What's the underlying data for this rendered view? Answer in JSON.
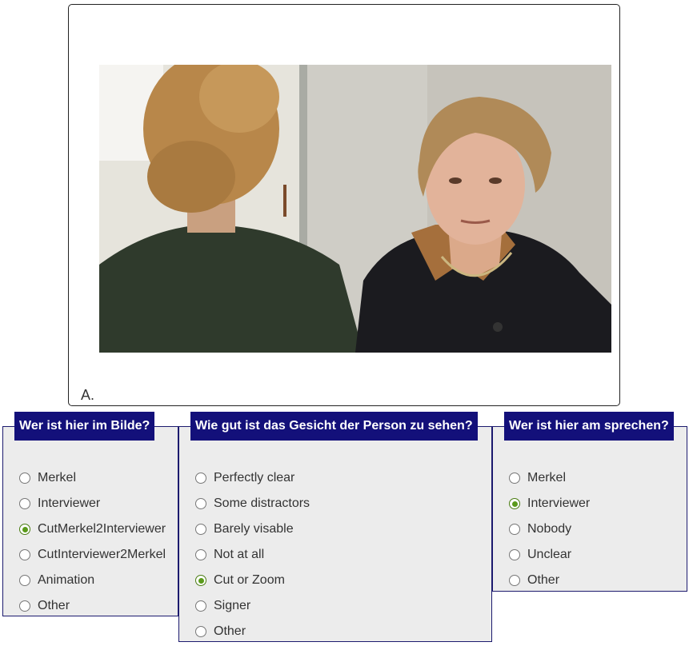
{
  "image": {
    "caption": "A."
  },
  "questions": [
    {
      "title": "Wer ist hier im Bilde?",
      "options": [
        "Merkel",
        "Interviewer",
        "CutMerkel2Interviewer",
        "CutInterviewer2Merkel",
        "Animation",
        "Other"
      ],
      "selected": "CutMerkel2Interviewer"
    },
    {
      "title": "Wie gut ist das Gesicht der Person zu sehen?",
      "options": [
        "Perfectly clear",
        "Some distractors",
        "Barely visable",
        "Not at all",
        "Cut or Zoom",
        "Signer",
        "Other"
      ],
      "selected": "Cut or Zoom"
    },
    {
      "title": "Wer ist hier am sprechen?",
      "options": [
        "Merkel",
        "Interviewer",
        "Nobody",
        "Unclear",
        "Other"
      ],
      "selected": "Interviewer"
    }
  ],
  "colors": {
    "panel_header_bg": "#13107a",
    "panel_bg": "#ececec",
    "radio_checked": "#5a9a1a"
  }
}
